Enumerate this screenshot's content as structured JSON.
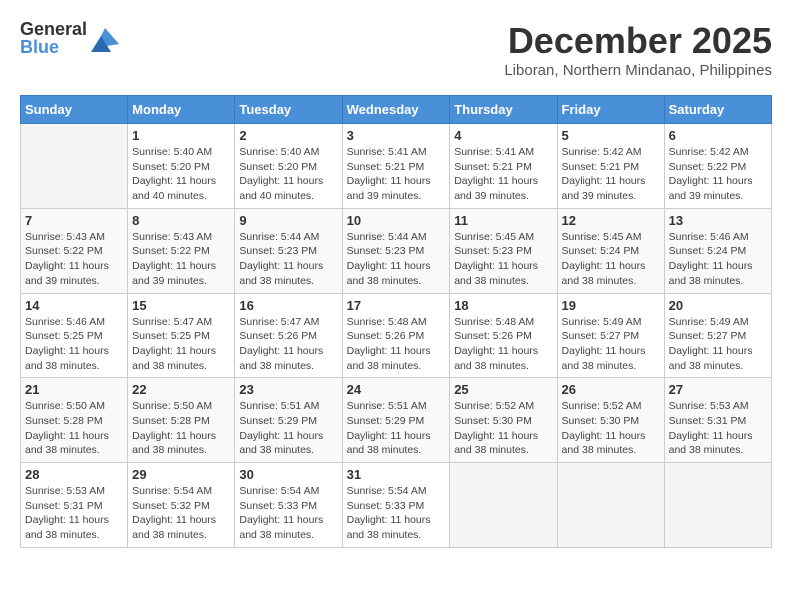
{
  "header": {
    "logo_general": "General",
    "logo_blue": "Blue",
    "month_title": "December 2025",
    "location": "Liboran, Northern Mindanao, Philippines"
  },
  "days_of_week": [
    "Sunday",
    "Monday",
    "Tuesday",
    "Wednesday",
    "Thursday",
    "Friday",
    "Saturday"
  ],
  "weeks": [
    [
      {
        "day": "",
        "sunrise": "",
        "sunset": "",
        "daylight": ""
      },
      {
        "day": "1",
        "sunrise": "Sunrise: 5:40 AM",
        "sunset": "Sunset: 5:20 PM",
        "daylight": "Daylight: 11 hours and 40 minutes."
      },
      {
        "day": "2",
        "sunrise": "Sunrise: 5:40 AM",
        "sunset": "Sunset: 5:20 PM",
        "daylight": "Daylight: 11 hours and 40 minutes."
      },
      {
        "day": "3",
        "sunrise": "Sunrise: 5:41 AM",
        "sunset": "Sunset: 5:21 PM",
        "daylight": "Daylight: 11 hours and 39 minutes."
      },
      {
        "day": "4",
        "sunrise": "Sunrise: 5:41 AM",
        "sunset": "Sunset: 5:21 PM",
        "daylight": "Daylight: 11 hours and 39 minutes."
      },
      {
        "day": "5",
        "sunrise": "Sunrise: 5:42 AM",
        "sunset": "Sunset: 5:21 PM",
        "daylight": "Daylight: 11 hours and 39 minutes."
      },
      {
        "day": "6",
        "sunrise": "Sunrise: 5:42 AM",
        "sunset": "Sunset: 5:22 PM",
        "daylight": "Daylight: 11 hours and 39 minutes."
      }
    ],
    [
      {
        "day": "7",
        "sunrise": "Sunrise: 5:43 AM",
        "sunset": "Sunset: 5:22 PM",
        "daylight": "Daylight: 11 hours and 39 minutes."
      },
      {
        "day": "8",
        "sunrise": "Sunrise: 5:43 AM",
        "sunset": "Sunset: 5:22 PM",
        "daylight": "Daylight: 11 hours and 39 minutes."
      },
      {
        "day": "9",
        "sunrise": "Sunrise: 5:44 AM",
        "sunset": "Sunset: 5:23 PM",
        "daylight": "Daylight: 11 hours and 38 minutes."
      },
      {
        "day": "10",
        "sunrise": "Sunrise: 5:44 AM",
        "sunset": "Sunset: 5:23 PM",
        "daylight": "Daylight: 11 hours and 38 minutes."
      },
      {
        "day": "11",
        "sunrise": "Sunrise: 5:45 AM",
        "sunset": "Sunset: 5:23 PM",
        "daylight": "Daylight: 11 hours and 38 minutes."
      },
      {
        "day": "12",
        "sunrise": "Sunrise: 5:45 AM",
        "sunset": "Sunset: 5:24 PM",
        "daylight": "Daylight: 11 hours and 38 minutes."
      },
      {
        "day": "13",
        "sunrise": "Sunrise: 5:46 AM",
        "sunset": "Sunset: 5:24 PM",
        "daylight": "Daylight: 11 hours and 38 minutes."
      }
    ],
    [
      {
        "day": "14",
        "sunrise": "Sunrise: 5:46 AM",
        "sunset": "Sunset: 5:25 PM",
        "daylight": "Daylight: 11 hours and 38 minutes."
      },
      {
        "day": "15",
        "sunrise": "Sunrise: 5:47 AM",
        "sunset": "Sunset: 5:25 PM",
        "daylight": "Daylight: 11 hours and 38 minutes."
      },
      {
        "day": "16",
        "sunrise": "Sunrise: 5:47 AM",
        "sunset": "Sunset: 5:26 PM",
        "daylight": "Daylight: 11 hours and 38 minutes."
      },
      {
        "day": "17",
        "sunrise": "Sunrise: 5:48 AM",
        "sunset": "Sunset: 5:26 PM",
        "daylight": "Daylight: 11 hours and 38 minutes."
      },
      {
        "day": "18",
        "sunrise": "Sunrise: 5:48 AM",
        "sunset": "Sunset: 5:26 PM",
        "daylight": "Daylight: 11 hours and 38 minutes."
      },
      {
        "day": "19",
        "sunrise": "Sunrise: 5:49 AM",
        "sunset": "Sunset: 5:27 PM",
        "daylight": "Daylight: 11 hours and 38 minutes."
      },
      {
        "day": "20",
        "sunrise": "Sunrise: 5:49 AM",
        "sunset": "Sunset: 5:27 PM",
        "daylight": "Daylight: 11 hours and 38 minutes."
      }
    ],
    [
      {
        "day": "21",
        "sunrise": "Sunrise: 5:50 AM",
        "sunset": "Sunset: 5:28 PM",
        "daylight": "Daylight: 11 hours and 38 minutes."
      },
      {
        "day": "22",
        "sunrise": "Sunrise: 5:50 AM",
        "sunset": "Sunset: 5:28 PM",
        "daylight": "Daylight: 11 hours and 38 minutes."
      },
      {
        "day": "23",
        "sunrise": "Sunrise: 5:51 AM",
        "sunset": "Sunset: 5:29 PM",
        "daylight": "Daylight: 11 hours and 38 minutes."
      },
      {
        "day": "24",
        "sunrise": "Sunrise: 5:51 AM",
        "sunset": "Sunset: 5:29 PM",
        "daylight": "Daylight: 11 hours and 38 minutes."
      },
      {
        "day": "25",
        "sunrise": "Sunrise: 5:52 AM",
        "sunset": "Sunset: 5:30 PM",
        "daylight": "Daylight: 11 hours and 38 minutes."
      },
      {
        "day": "26",
        "sunrise": "Sunrise: 5:52 AM",
        "sunset": "Sunset: 5:30 PM",
        "daylight": "Daylight: 11 hours and 38 minutes."
      },
      {
        "day": "27",
        "sunrise": "Sunrise: 5:53 AM",
        "sunset": "Sunset: 5:31 PM",
        "daylight": "Daylight: 11 hours and 38 minutes."
      }
    ],
    [
      {
        "day": "28",
        "sunrise": "Sunrise: 5:53 AM",
        "sunset": "Sunset: 5:31 PM",
        "daylight": "Daylight: 11 hours and 38 minutes."
      },
      {
        "day": "29",
        "sunrise": "Sunrise: 5:54 AM",
        "sunset": "Sunset: 5:32 PM",
        "daylight": "Daylight: 11 hours and 38 minutes."
      },
      {
        "day": "30",
        "sunrise": "Sunrise: 5:54 AM",
        "sunset": "Sunset: 5:33 PM",
        "daylight": "Daylight: 11 hours and 38 minutes."
      },
      {
        "day": "31",
        "sunrise": "Sunrise: 5:54 AM",
        "sunset": "Sunset: 5:33 PM",
        "daylight": "Daylight: 11 hours and 38 minutes."
      },
      {
        "day": "",
        "sunrise": "",
        "sunset": "",
        "daylight": ""
      },
      {
        "day": "",
        "sunrise": "",
        "sunset": "",
        "daylight": ""
      },
      {
        "day": "",
        "sunrise": "",
        "sunset": "",
        "daylight": ""
      }
    ]
  ]
}
